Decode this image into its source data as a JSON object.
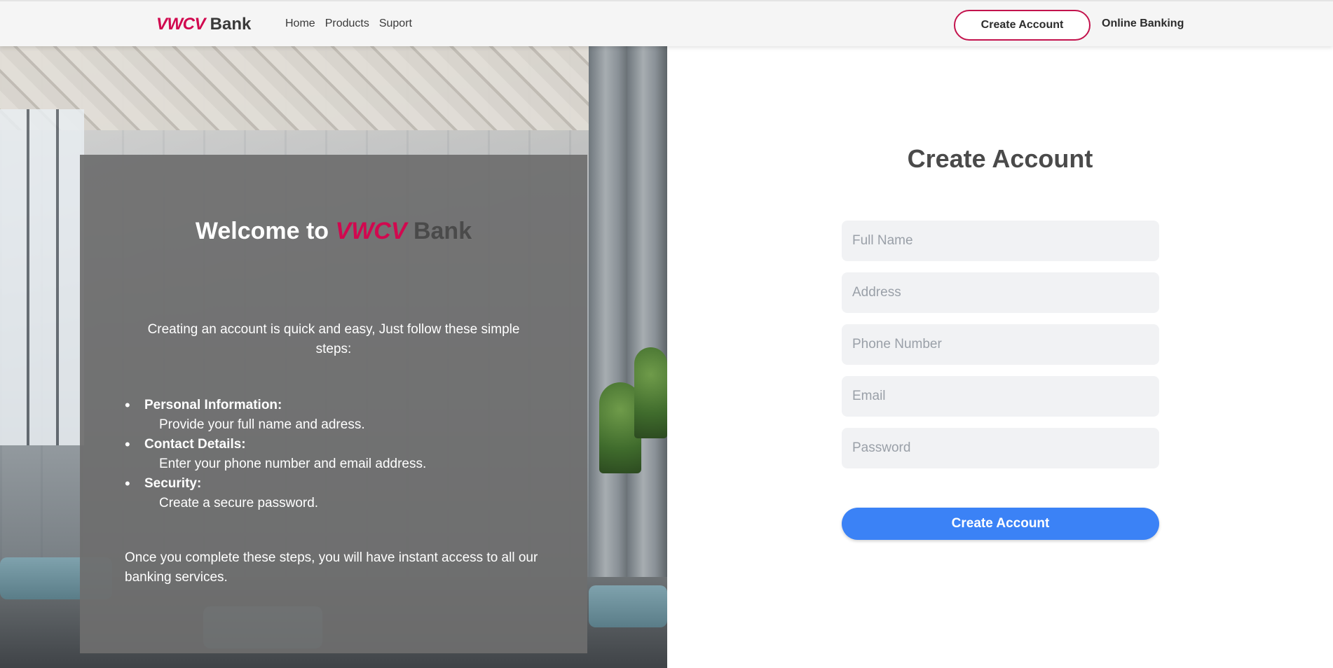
{
  "nav": {
    "brand": "VWCV",
    "bank": "Bank",
    "links": [
      "Home",
      "Products",
      "Suport"
    ],
    "create_account": "Create Account",
    "online_banking": "Online Banking"
  },
  "welcome": {
    "title_prefix": "Welcome to",
    "brand": "VWCV",
    "bank": "Bank",
    "intro": "Creating an account is quick and easy, Just follow these simple steps:",
    "steps": [
      {
        "title": "Personal Information:",
        "desc": "Provide your full name and adress."
      },
      {
        "title": "Contact Details:",
        "desc": "Enter your phone number and email address."
      },
      {
        "title": "Security:",
        "desc": "Create a secure password."
      }
    ],
    "outro": "Once you complete these steps, you will have instant access to all our banking services."
  },
  "form": {
    "title": "Create Account",
    "fields": {
      "full_name": "Full Name",
      "address": "Address",
      "phone": "Phone Number",
      "email": "Email",
      "password": "Password"
    },
    "submit": "Create Account"
  },
  "colors": {
    "brand": "#d1084f",
    "button_primary": "#3b82f6",
    "nav_bg": "#f5f5f5"
  }
}
